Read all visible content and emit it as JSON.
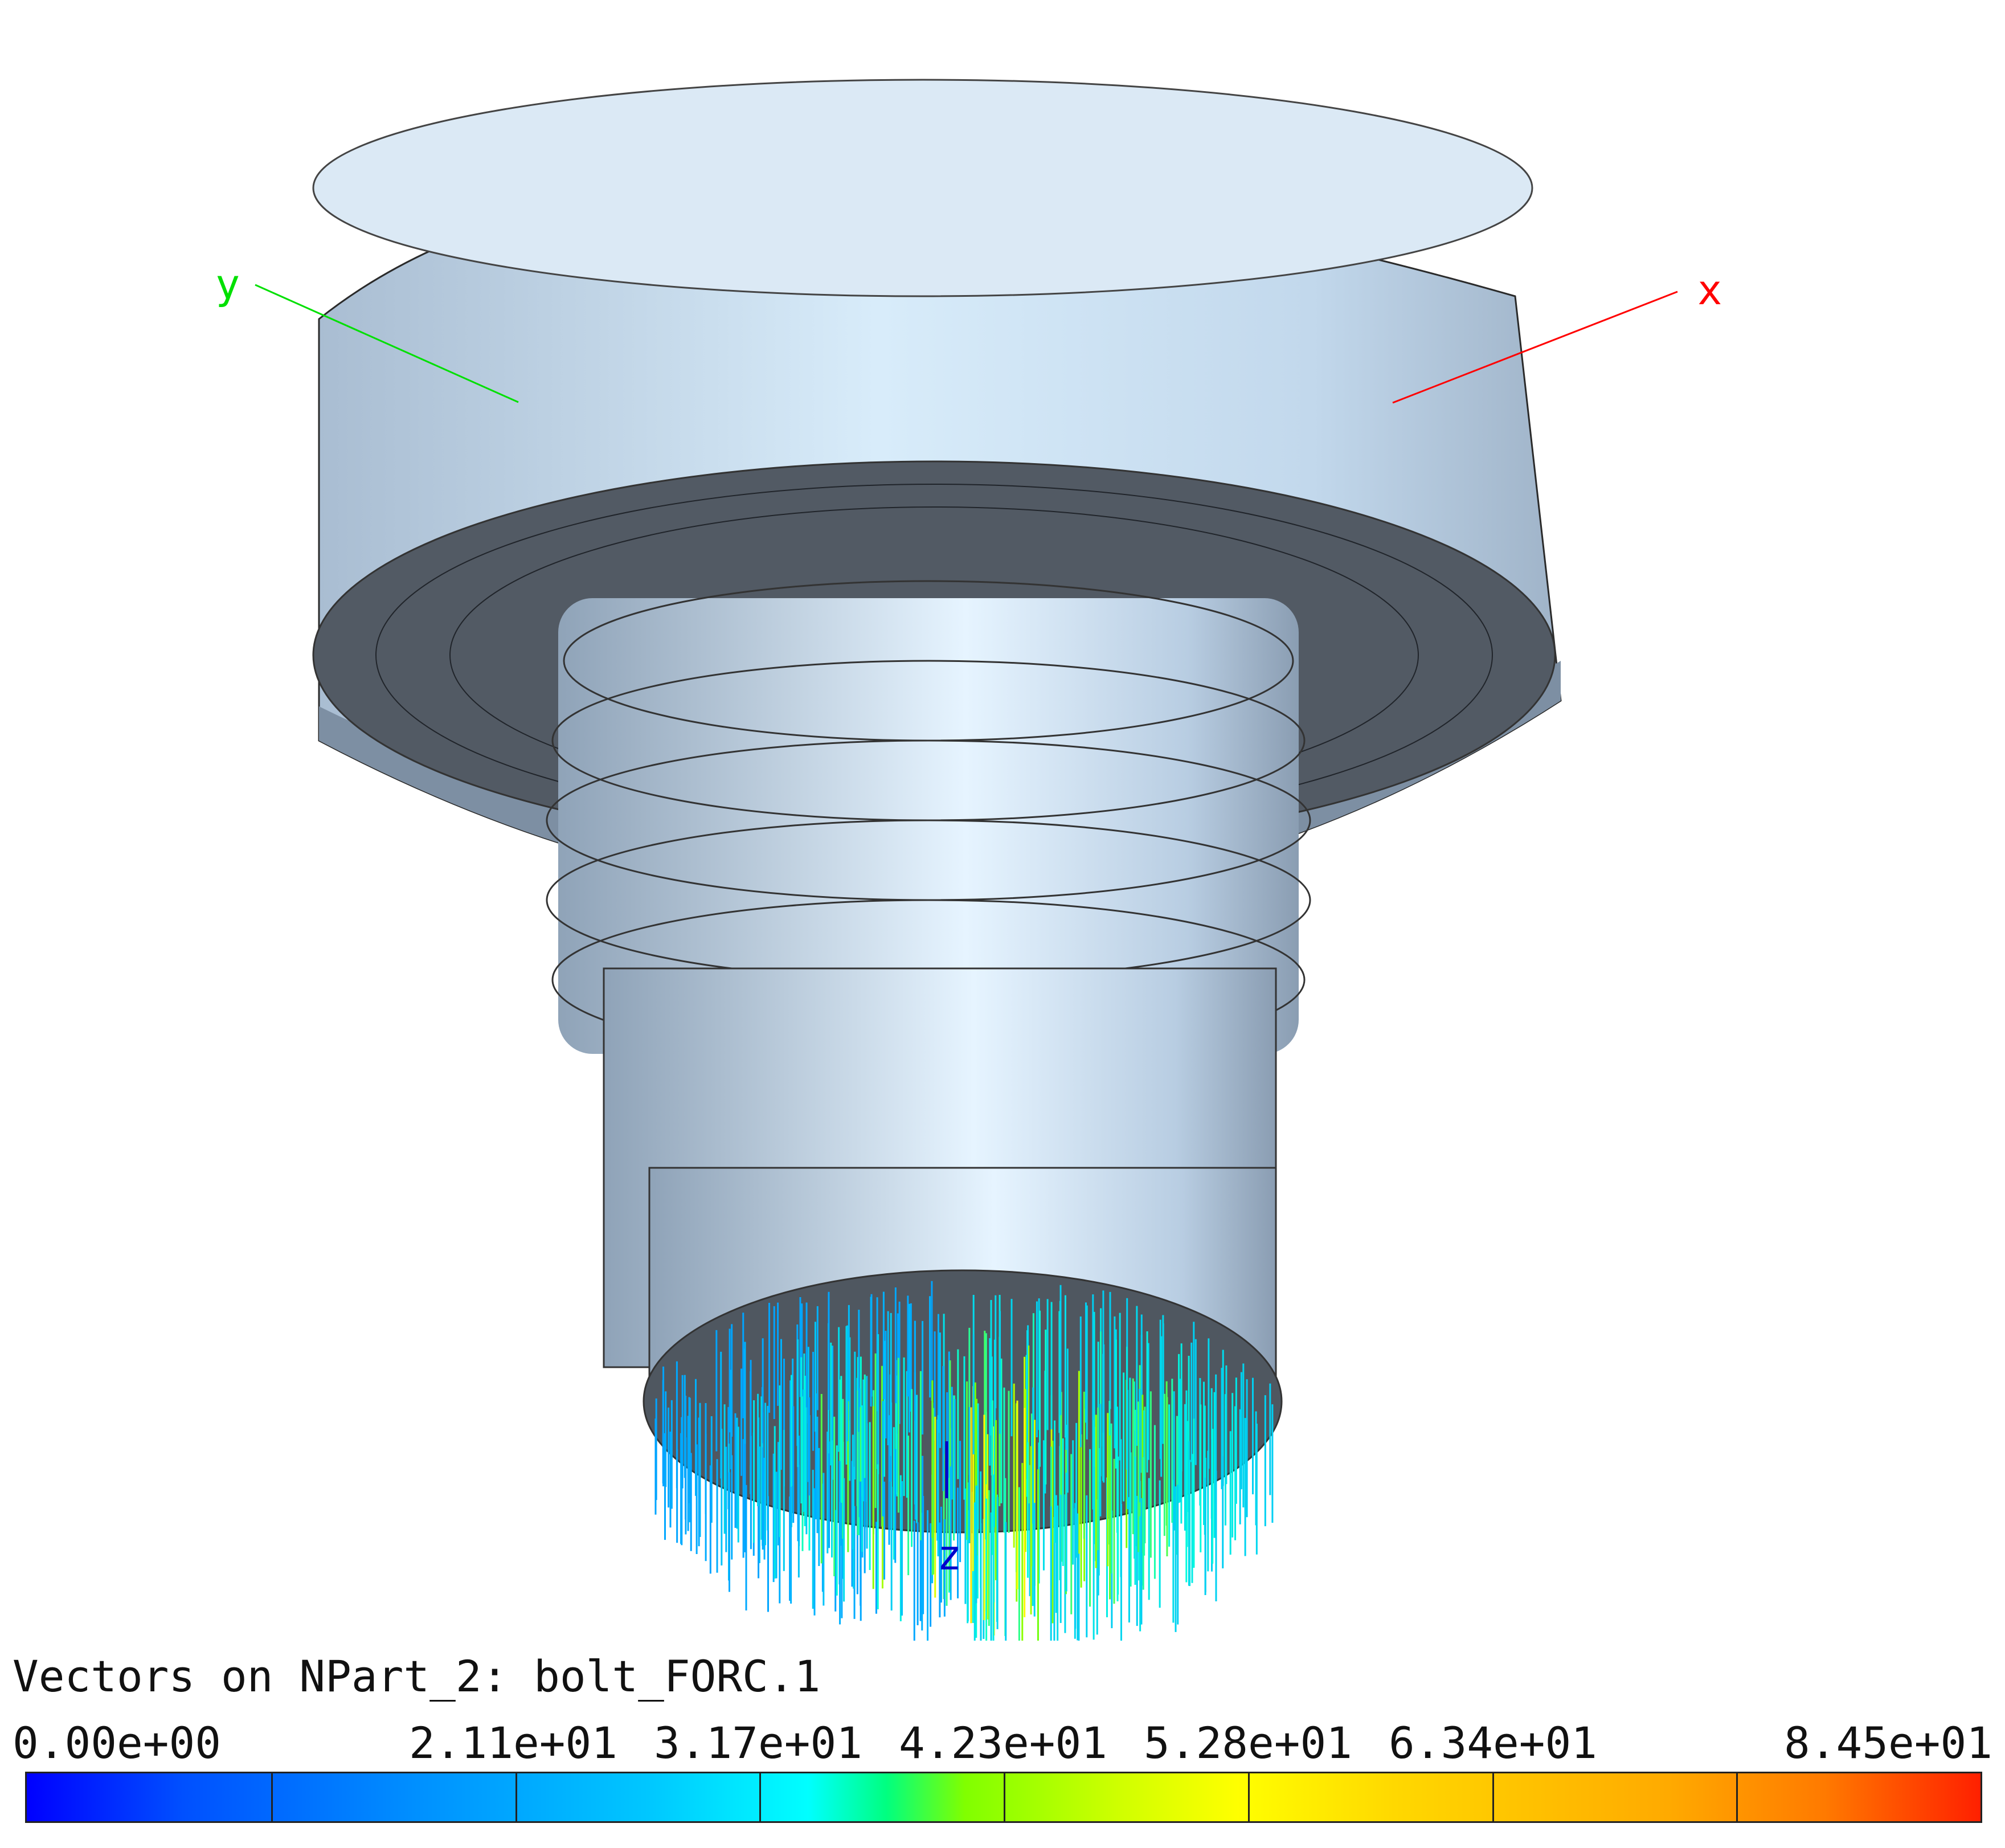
{
  "viewport": {
    "axes": {
      "x_label": "x",
      "y_label": "y",
      "z_label": "z",
      "x_color": "#ff0000",
      "y_color": "#00e000",
      "z_color": "#0000cc"
    },
    "model_color": "#c6dcf0",
    "face_color": "#525a64"
  },
  "legend": {
    "title": "Vectors on NPart_2: bolt_FORC.1",
    "min": 0.0,
    "max": 84.5,
    "tick_labels": [
      "0.00e+00",
      "2.11e+01",
      "3.17e+01",
      "4.23e+01",
      "5.28e+01",
      "6.34e+01",
      "8.45e+01"
    ],
    "tick_values": [
      0.0,
      21.1,
      31.7,
      42.3,
      52.8,
      63.4,
      84.5
    ],
    "divisions": 8
  }
}
